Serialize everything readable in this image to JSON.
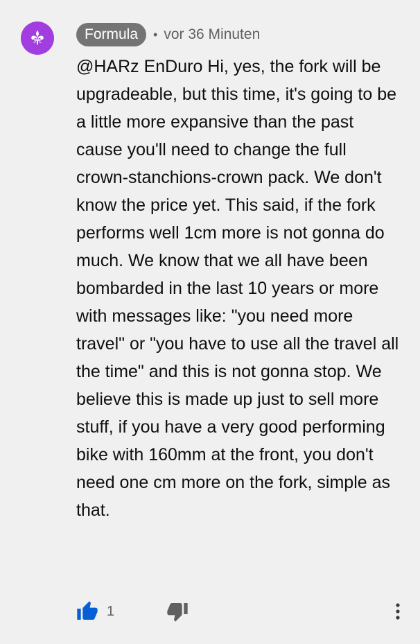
{
  "comment": {
    "author": "Formula",
    "separator": "•",
    "timestamp": "vor 36 Minuten",
    "text": "@HARz EnDuro Hi, yes, the fork will be upgradeable, but this time, it's going to be a little more expansive than the past cause you'll need to change the full crown-stanchions-crown pack. We don't know the price yet. This said, if the fork performs well 1cm more is not gonna do much. We know that we all have been bombarded in the last 10 years or more with messages like: \"you need more travel\" or \"you have to use all the travel all the time\" and this is not gonna stop. We believe this is made up just to sell more stuff, if you have a very good performing bike with 160mm at the front, you don't need one cm more on the fork, simple as that.",
    "like_count": "1"
  },
  "icons": {
    "avatar": "fleur-de-lis-icon",
    "like": "thumbs-up-icon",
    "dislike": "thumbs-down-icon",
    "more": "more-vertical-icon"
  },
  "colors": {
    "background": "#f0f0f0",
    "avatar": "#a23ee0",
    "author_chip": "#747474",
    "like_active": "#065fd4",
    "icon_gray": "#606060"
  }
}
